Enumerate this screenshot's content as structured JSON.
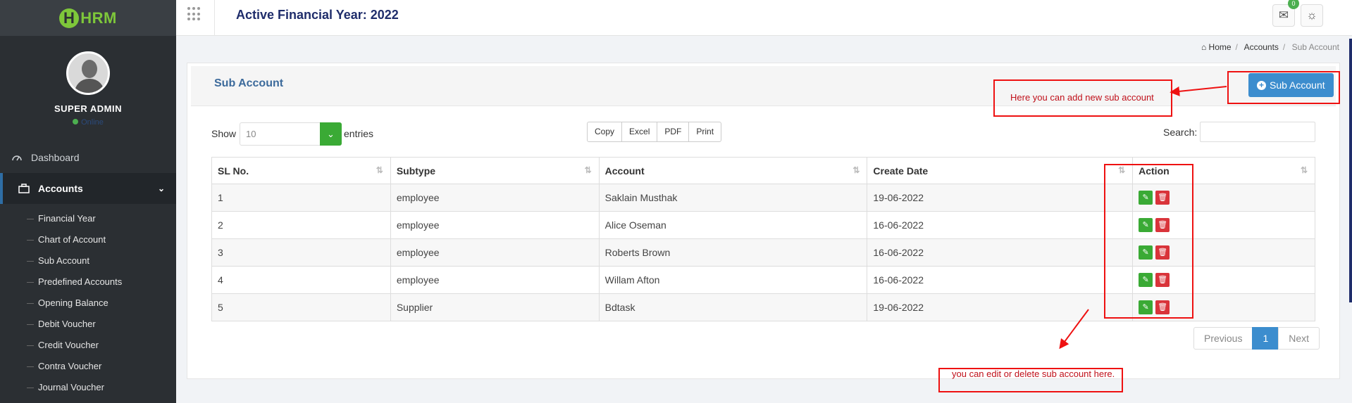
{
  "app": {
    "logo_text": "HRM",
    "logo_h": "H",
    "profile_name": "SUPER ADMIN",
    "online_status": "Online"
  },
  "sidebar": {
    "dashboard_label": "Dashboard",
    "accounts_label": "Accounts",
    "sub_items": [
      "Financial Year",
      "Chart of Account",
      "Sub Account",
      "Predefined Accounts",
      "Opening Balance",
      "Debit Voucher",
      "Credit Voucher",
      "Contra Voucher",
      "Journal Voucher"
    ]
  },
  "topbar": {
    "title": "Active Financial Year: 2022",
    "mail_badge": "0"
  },
  "breadcrumb": {
    "home": "Home",
    "section": "Accounts",
    "current": "Sub Account"
  },
  "panel": {
    "title": "Sub Account",
    "add_button": "Sub Account"
  },
  "controls": {
    "show_label": "Show",
    "entries_value": "10",
    "entries_label": "entries",
    "export_buttons": [
      "Copy",
      "Excel",
      "PDF",
      "Print"
    ],
    "search_label": "Search:"
  },
  "table": {
    "headers": [
      "SL No.",
      "Subtype",
      "Account",
      "Create Date",
      "Action"
    ],
    "rows": [
      [
        "1",
        "employee",
        "Saklain Musthak",
        "19-06-2022"
      ],
      [
        "2",
        "employee",
        "Alice Oseman",
        "16-06-2022"
      ],
      [
        "3",
        "employee",
        "Roberts Brown",
        "16-06-2022"
      ],
      [
        "4",
        "employee",
        "Willam Afton",
        "16-06-2022"
      ],
      [
        "5",
        "Supplier",
        "Bdtask",
        "19-06-2022"
      ]
    ]
  },
  "pagination": {
    "previous": "Previous",
    "page": "1",
    "next": "Next"
  },
  "annotations": {
    "add_note": "Here you can add new sub account",
    "edit_note": "you can edit or delete sub account here."
  },
  "colors": {
    "accent_blue": "#3c8dce",
    "edit_green": "#3aaa35",
    "delete_red": "#d9343a",
    "annotation_red": "#e11111"
  }
}
